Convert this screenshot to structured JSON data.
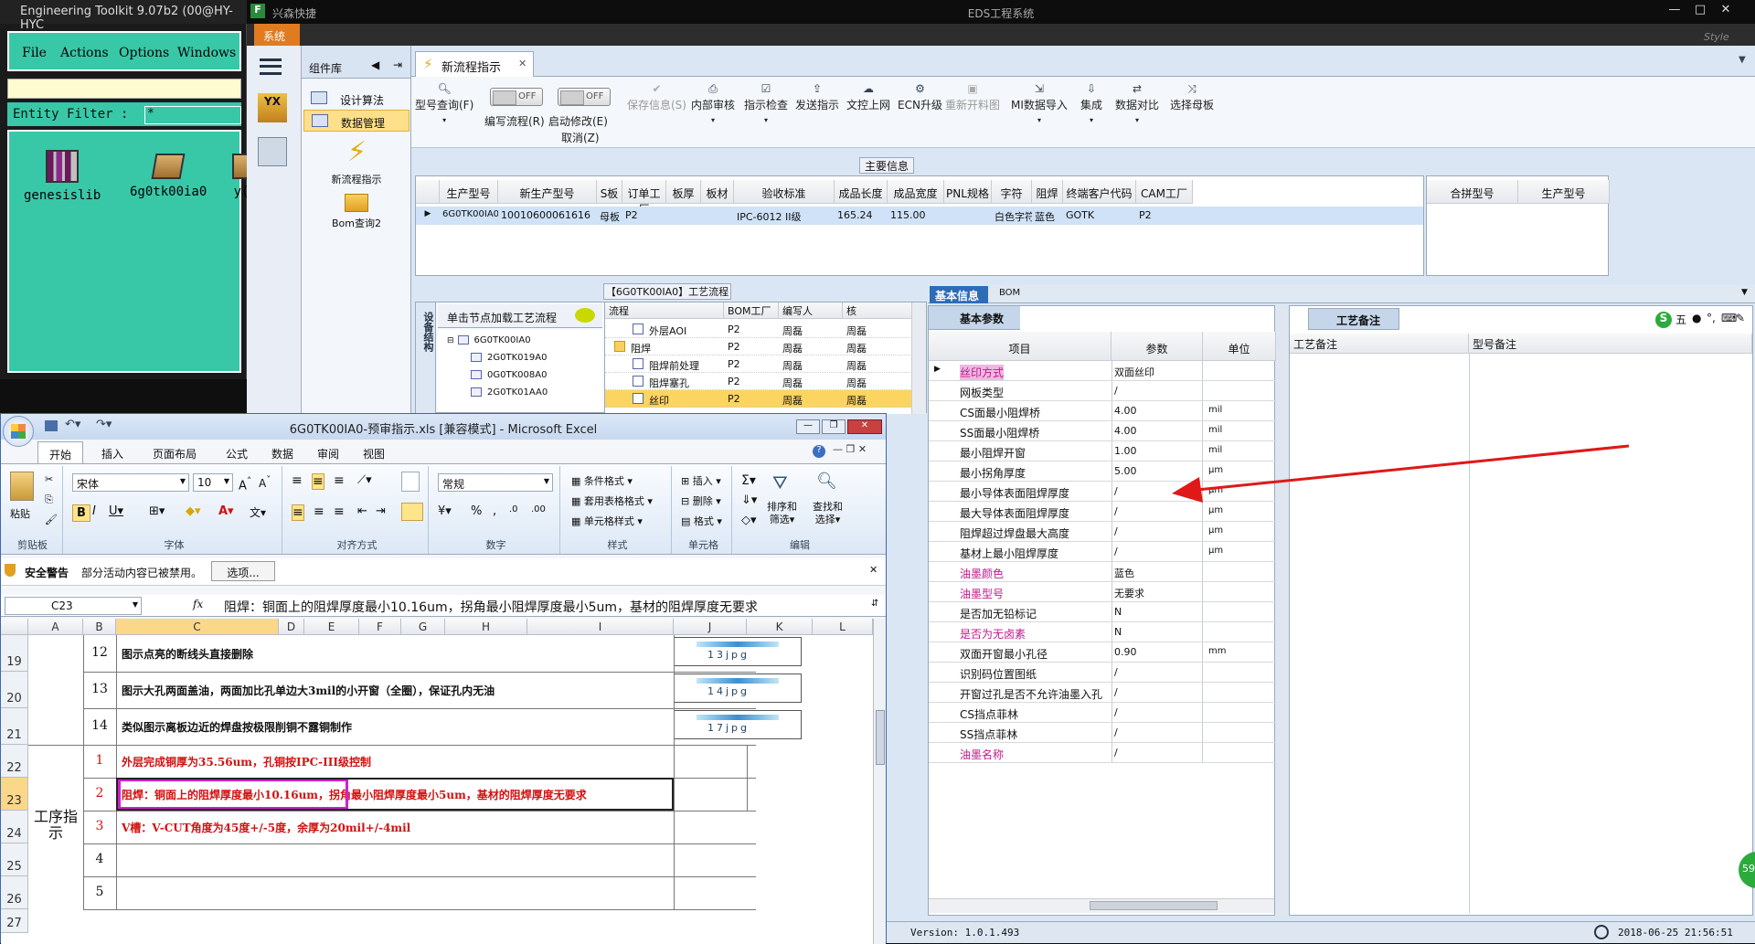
{
  "toolkit": {
    "title": "Engineering Toolkit 9.07b2 (00@HY-HYC",
    "menu": [
      "File",
      "Actions",
      "Options",
      "Windows"
    ],
    "filter_label": "Entity Filter :",
    "filter_value": "*",
    "jobs": [
      "genesislib",
      "6g0tk00ia0",
      "y("
    ]
  },
  "eds": {
    "taskbar_app": "兴森快捷",
    "window_title": "EDS工程系统",
    "system_tab": "系统",
    "watermark": "Style",
    "component_lib": "组件库",
    "nav_items": [
      "设计算法",
      "数据管理"
    ],
    "big_items": [
      "新流程指示",
      "Bom查询2"
    ],
    "active_tab": "新流程指示",
    "toolbar": [
      {
        "label": "型号查询(F)",
        "icon": "search-icon"
      },
      {
        "label": "编写流程(R)",
        "icon": "toggle-icon",
        "toggle": "OFF"
      },
      {
        "label": "启动修改(E)",
        "label2": "取消(Z)",
        "icon": "toggle-icon",
        "toggle": "OFF"
      },
      {
        "label": "保存信息(S)",
        "icon": "check-icon",
        "disabled": true
      },
      {
        "label": "内部审核",
        "icon": "printer-icon"
      },
      {
        "label": "指示检查",
        "icon": "checkbox-icon"
      },
      {
        "label": "发送指示",
        "icon": "upload-icon"
      },
      {
        "label": "文控上网",
        "icon": "cloud-upload-icon"
      },
      {
        "label": "ECN升级",
        "icon": "ecn-icon"
      },
      {
        "label": "重新开料图",
        "icon": "image-icon",
        "disabled": true
      },
      {
        "label": "MI数据导入",
        "icon": "import-icon"
      },
      {
        "label": "集成",
        "icon": "download-icon"
      },
      {
        "label": "数据对比",
        "icon": "compare-icon"
      },
      {
        "label": "选择母板",
        "icon": "shuffle-icon"
      }
    ],
    "main_info": {
      "title": "主要信息",
      "columns": [
        "生产型号",
        "新生产型号",
        "S板",
        "订单工厂",
        "板厚",
        "板材",
        "验收标准",
        "成品长度",
        "成品宽度",
        "PNL规格",
        "字符",
        "阻焊",
        "终端客户代码",
        "CAM工厂"
      ],
      "row": [
        "6G0TK00IA0",
        "10010600061616",
        "母板",
        "P2",
        "",
        "",
        "IPC-6012 II级",
        "165.24",
        "115.00",
        "",
        "白色字符",
        "蓝色",
        "GOTK",
        "P2"
      ],
      "side_columns": [
        "合拼型号",
        "生产型号"
      ]
    },
    "flow": {
      "title": "【6G0TK00IA0】工艺流程",
      "side_label": "设备结构",
      "load_hint": "单击节点加载工艺流程",
      "tree": [
        "6G0TK00IA0",
        "2G0TK019A0",
        "0G0TK008A0",
        "2G0TK01AA0"
      ],
      "columns": [
        "流程",
        "BOM工厂",
        "编写人",
        "核"
      ],
      "rows": [
        {
          "name": "外层AOI",
          "bom": "P2",
          "author": "周磊",
          "check": "周磊"
        },
        {
          "name": "阻焊",
          "bom": "P2",
          "author": "周磊",
          "check": "周磊"
        },
        {
          "name": "阻焊前处理",
          "bom": "P2",
          "author": "周磊",
          "check": "周磊"
        },
        {
          "name": "阻焊塞孔",
          "bom": "P2",
          "author": "周磊",
          "check": "周磊"
        },
        {
          "name": "丝印",
          "bom": "P2",
          "author": "周磊",
          "check": "周磊"
        }
      ]
    },
    "base_info": {
      "tabs": [
        "基本信息",
        "BOM"
      ],
      "subtab": "基本参数",
      "columns": [
        "项目",
        "参数",
        "单位"
      ],
      "rows": [
        {
          "item": "丝印方式",
          "value": "双面丝印",
          "unit": "",
          "pink": true
        },
        {
          "item": "网板类型",
          "value": "/",
          "unit": ""
        },
        {
          "item": "CS面最小阻焊桥",
          "value": "4.00",
          "unit": "mil"
        },
        {
          "item": "SS面最小阻焊桥",
          "value": "4.00",
          "unit": "mil"
        },
        {
          "item": "最小阻焊开窗",
          "value": "1.00",
          "unit": "mil"
        },
        {
          "item": "最小拐角厚度",
          "value": "5.00",
          "unit": "μm"
        },
        {
          "item": "最小导体表面阻焊厚度",
          "value": "/",
          "unit": "μm"
        },
        {
          "item": "最大导体表面阻焊厚度",
          "value": "/",
          "unit": "μm"
        },
        {
          "item": "阻焊超过焊盘最大高度",
          "value": "/",
          "unit": "μm"
        },
        {
          "item": "基材上最小阻焊厚度",
          "value": "/",
          "unit": "μm"
        },
        {
          "item": "油墨颜色",
          "value": "蓝色",
          "unit": "",
          "pink": true
        },
        {
          "item": "油墨型号",
          "value": "无要求",
          "unit": "",
          "pink": true
        },
        {
          "item": "是否加无铅标记",
          "value": "N",
          "unit": ""
        },
        {
          "item": "是否为无卤素",
          "value": "N",
          "unit": "",
          "pink": true
        },
        {
          "item": "双面开窗最小孔径",
          "value": "0.90",
          "unit": "mm"
        },
        {
          "item": "识别码位置图纸",
          "value": "/",
          "unit": ""
        },
        {
          "item": "开窗过孔是否不允许油墨入孔",
          "value": "/",
          "unit": ""
        },
        {
          "item": "CS挡点菲林",
          "value": "/",
          "unit": ""
        },
        {
          "item": "SS挡点菲林",
          "value": "/",
          "unit": ""
        },
        {
          "item": "油墨名称",
          "value": "/",
          "unit": "",
          "pink": true
        }
      ],
      "remarks_tab": "工艺备注",
      "remarks_columns": [
        "工艺备注",
        "型号备注"
      ]
    },
    "ime": "五",
    "status_version": "Version: 1.0.1.493",
    "status_time": "2018-06-25 21:56:51",
    "badge": "59"
  },
  "excel": {
    "title": "6G0TK00IA0-预审指示.xls [兼容模式] - Microsoft Excel",
    "tabs": [
      "开始",
      "插入",
      "页面布局",
      "公式",
      "数据",
      "审阅",
      "视图"
    ],
    "font_name": "宋体",
    "font_size": "10",
    "number_format": "常规",
    "groups": [
      "剪贴板",
      "字体",
      "对齐方式",
      "数字",
      "样式",
      "单元格",
      "编辑"
    ],
    "paste": "粘贴",
    "style_btns": [
      "条件格式",
      "套用表格格式",
      "单元格样式"
    ],
    "cell_btns": [
      "插入",
      "删除",
      "格式"
    ],
    "edit_btns": [
      "排序和",
      "筛选",
      "查找和",
      "选择"
    ],
    "security_title": "安全警告",
    "security_text": "部分活动内容已被禁用。",
    "security_btn": "选项...",
    "cell_ref": "C23",
    "formula": "阻焊：铜面上的阻焊厚度最小10.16um，拐角最小阻焊厚度最小5um，基材的阻焊厚度无要求",
    "columns": [
      "A",
      "B",
      "C",
      "D",
      "E",
      "F",
      "G",
      "H",
      "I",
      "J",
      "K",
      "L"
    ],
    "rows": [
      {
        "row": "19",
        "num": "12",
        "text": "图示点亮的断线头直接删除",
        "img": "13jpg"
      },
      {
        "row": "20",
        "num": "13",
        "text": "图示大孔两面盖油，两面加比孔单边大3mil的小开窗（全圈），保证孔内无油",
        "img": "14jpg"
      },
      {
        "row": "21",
        "num": "14",
        "text": "类似图示离板边近的焊盘按极限削铜不露铜制作",
        "img": "17jpg"
      },
      {
        "row": "22",
        "num": "1",
        "text": "外层完成铜厚为35.56um，孔铜按IPC-III级控制",
        "red": true
      },
      {
        "row": "23",
        "num": "2",
        "text": "阻焊：铜面上的阻焊厚度最小10.16um，拐角最小阻焊厚度最小5um，基材的阻焊厚度无要求",
        "red": true
      },
      {
        "row": "24",
        "num": "3",
        "text": "V槽：V-CUT角度为45度+/-5度，余厚为20mil+/-4mil",
        "red": true
      },
      {
        "row": "25",
        "num": "4",
        "text": ""
      },
      {
        "row": "26",
        "num": "5",
        "text": ""
      },
      {
        "row": "27",
        "num": "",
        "text": ""
      }
    ],
    "section_label": "工序指示"
  }
}
